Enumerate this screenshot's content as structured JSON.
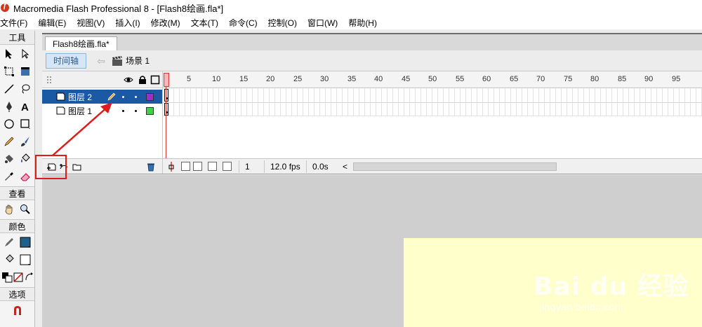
{
  "window": {
    "title": "Macromedia Flash Professional 8 - [Flash8绘画.fla*]"
  },
  "menu": [
    "文件(F)",
    "编辑(E)",
    "视图(V)",
    "插入(I)",
    "修改(M)",
    "文本(T)",
    "命令(C)",
    "控制(O)",
    "窗口(W)",
    "帮助(H)"
  ],
  "tools": {
    "header": "工具",
    "view_label": "查看",
    "colors_label": "颜色",
    "options_label": "选项",
    "stroke_color": "#1f5f8b",
    "fill_color": "#ffffff"
  },
  "document": {
    "tab": "Flash8绘画.fla*",
    "timeline_button": "时间轴",
    "scene": "场景 1"
  },
  "timeline": {
    "ruler": [
      "5",
      "10",
      "15",
      "20",
      "25",
      "30",
      "35",
      "40",
      "45",
      "50",
      "55",
      "60",
      "65",
      "70",
      "75",
      "80",
      "85",
      "90",
      "95"
    ],
    "layers": [
      {
        "name": "图层 2",
        "selected": true,
        "color": "#9b30c9"
      },
      {
        "name": "图层 1",
        "selected": false,
        "color": "#3fd14a"
      }
    ],
    "current_frame": "1",
    "fps": "12.0 fps",
    "time": "0.0s",
    "scroll_left": "<"
  },
  "watermark": {
    "logo": "Bai du 经验",
    "sub": "jingyan.baidu.com"
  },
  "colors": {
    "stage": "#ffffcc",
    "annotation": "#e01b1b",
    "selected_layer": "#1b59a5"
  }
}
